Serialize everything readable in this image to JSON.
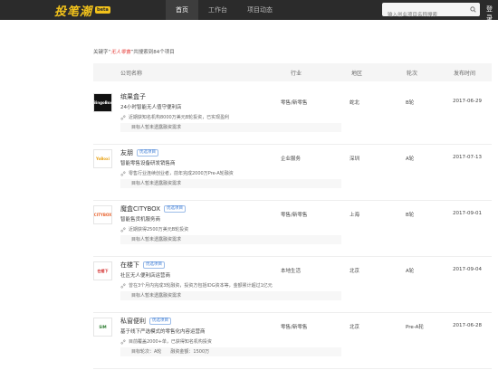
{
  "header": {
    "logo": "投笔潮",
    "logo_badge": "beta",
    "nav": [
      "首页",
      "工作台",
      "项目动态"
    ],
    "search_placeholder": "输入创业项目名称搜索",
    "login": "登录"
  },
  "summary": {
    "prefix": "关键字“",
    "keyword": "无人零售",
    "suffix": "”共搜索到84个项目"
  },
  "table": {
    "headers": [
      "公司名称",
      "行业",
      "地区",
      "轮次",
      "发布时间"
    ]
  },
  "rows": [
    {
      "logo_text": "BingoBox",
      "logo_bg": "#111111",
      "logo_fg": "#ffffff",
      "name": "缤果盒子",
      "tag": "",
      "desc": "24小时智能无人值守便利店",
      "news": "近期获知名机构8000万美元B轮投资，已实现盈利",
      "invest": "目标人暂未透露融资需求",
      "industry": "零售/新零售",
      "region": "蛇北",
      "round": "B轮",
      "date": "2017-06-29"
    },
    {
      "logo_text": "YoBoxi",
      "logo_bg": "#ffffff",
      "logo_fg": "#e8a317",
      "name": "友朋",
      "tag": "优选项目",
      "desc": "智能零售设备研发销售商",
      "news": "零售行业连续创业者，前年完成2000万Pre-A轮融资",
      "invest": "目标人暂未透露融资需求",
      "industry": "企业服务",
      "region": "深圳",
      "round": "A轮",
      "date": "2017-07-13"
    },
    {
      "logo_text": "CITYBOX",
      "logo_bg": "#ffffff",
      "logo_fg": "#e8612c",
      "name": "魔盒CITYBOX",
      "tag": "优选项目",
      "desc": "智能售货机服务商",
      "news": "近期获得2500万美元B轮投资",
      "invest": "目标人暂未透露融资需求",
      "industry": "零售/新零售",
      "region": "上海",
      "round": "B轮",
      "date": "2017-09-01"
    },
    {
      "logo_text": "在楼下",
      "logo_bg": "#ffffff",
      "logo_fg": "#d32f2f",
      "name": "在楼下",
      "tag": "优选项目",
      "desc": "社区无人便利店运营商",
      "news": "曾在3个月内完成3轮融资，投资方包括IDG资本等，金额累计超过1亿元",
      "invest": "目标人暂未透露融资需求",
      "industry": "本地生活",
      "region": "北京",
      "round": "A轮",
      "date": "2017-09-04"
    },
    {
      "logo_text": "SIM",
      "logo_bg": "#ffffff",
      "logo_fg": "#2e7d32",
      "name": "私窗便利",
      "tag": "优选项目",
      "desc": "基于线下严选模式的零售化内容运营商",
      "news": "目前覆盖2000+单，已获得知名机构投资",
      "invest": "目标轮次：A轮　　融资金额：1500万",
      "industry": "零售/新零售",
      "region": "北京",
      "round": "Pre-A轮",
      "date": "2017-06-28"
    }
  ]
}
